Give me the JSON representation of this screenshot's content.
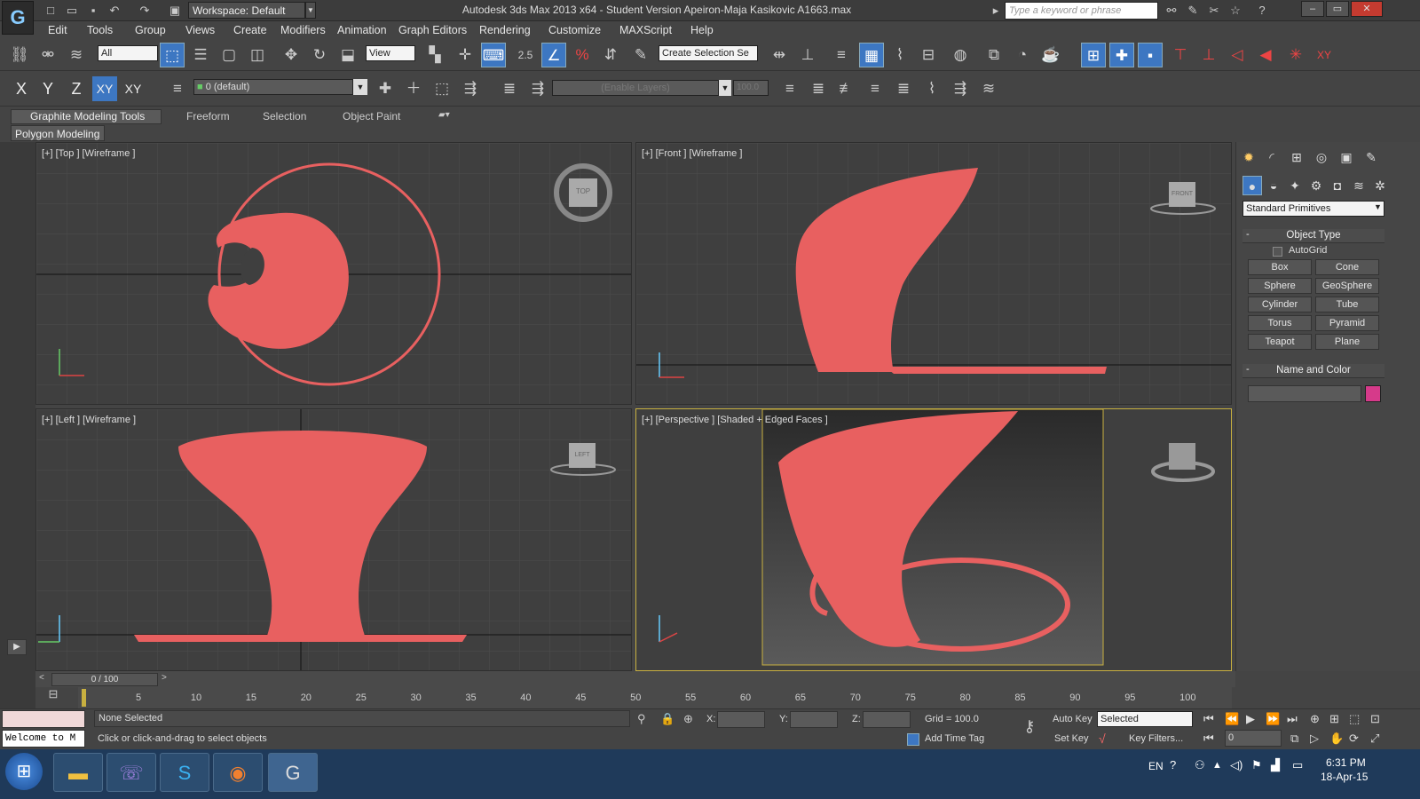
{
  "titlebar": {
    "workspace": "Workspace: Default",
    "app_title": "Autodesk 3ds Max  2013 x64  -  Student Version    Apeiron-Maja Kasikovic A1663.max",
    "search_placeholder": "Type a keyword or phrase"
  },
  "menu": [
    "Edit",
    "Tools",
    "Group",
    "Views",
    "Create",
    "Modifiers",
    "Animation",
    "Graph Editors",
    "Rendering",
    "Customize",
    "MAXScript",
    "Help"
  ],
  "toolbar": {
    "filter_value": "All",
    "refcoord_value": "View",
    "snap_angle": "2.5",
    "selection_set_placeholder": "Create Selection Se",
    "layer_value": "0 (default)",
    "enable_layers": "(Enable Layers)",
    "spinner_value": "100.0",
    "axes": [
      "X",
      "Y",
      "Z",
      "XY",
      "XY"
    ]
  },
  "ribbon": {
    "tabs": [
      "Graphite Modeling Tools",
      "Freeform",
      "Selection",
      "Object Paint"
    ],
    "panel": "Polygon Modeling"
  },
  "viewports": {
    "top": {
      "label": "[+] [Top ] [Wireframe ]",
      "cube": "TOP"
    },
    "front": {
      "label": "[+] [Front ] [Wireframe ]",
      "cube": "FRONT"
    },
    "left": {
      "label": "[+] [Left ] [Wireframe ]",
      "cube": "LEFT"
    },
    "perspective": {
      "label": "[+] [Perspective ] [Shaded + Edged Faces ]"
    }
  },
  "command_panel": {
    "category": "Standard Primitives",
    "object_type_title": "Object Type",
    "autogrid": "AutoGrid",
    "buttons": [
      "Box",
      "Cone",
      "Sphere",
      "GeoSphere",
      "Cylinder",
      "Tube",
      "Torus",
      "Pyramid",
      "Teapot",
      "Plane"
    ],
    "name_color_title": "Name and Color",
    "color": "#d63a8a"
  },
  "timeline": {
    "frame_readout": "0 / 100",
    "ticks": [
      "5",
      "10",
      "15",
      "20",
      "25",
      "30",
      "35",
      "40",
      "45",
      "50",
      "55",
      "60",
      "65",
      "70",
      "75",
      "80",
      "85",
      "90",
      "95",
      "100"
    ]
  },
  "status": {
    "maxscript": "Welcome to M",
    "selection": "None Selected",
    "prompt": "Click or click-and-drag to select objects",
    "x_label": "X:",
    "y_label": "Y:",
    "z_label": "Z:",
    "grid": "Grid = 100.0",
    "add_time_tag": "Add Time Tag",
    "auto_key": "Auto Key",
    "set_key": "Set Key",
    "selected": "Selected",
    "key_filters": "Key Filters...",
    "frame": "0"
  },
  "taskbar": {
    "lang": "EN",
    "time": "6:31 PM",
    "date": "18-Apr-15"
  },
  "colors": {
    "wire": "#e86060",
    "accent": "#3d77c2"
  }
}
